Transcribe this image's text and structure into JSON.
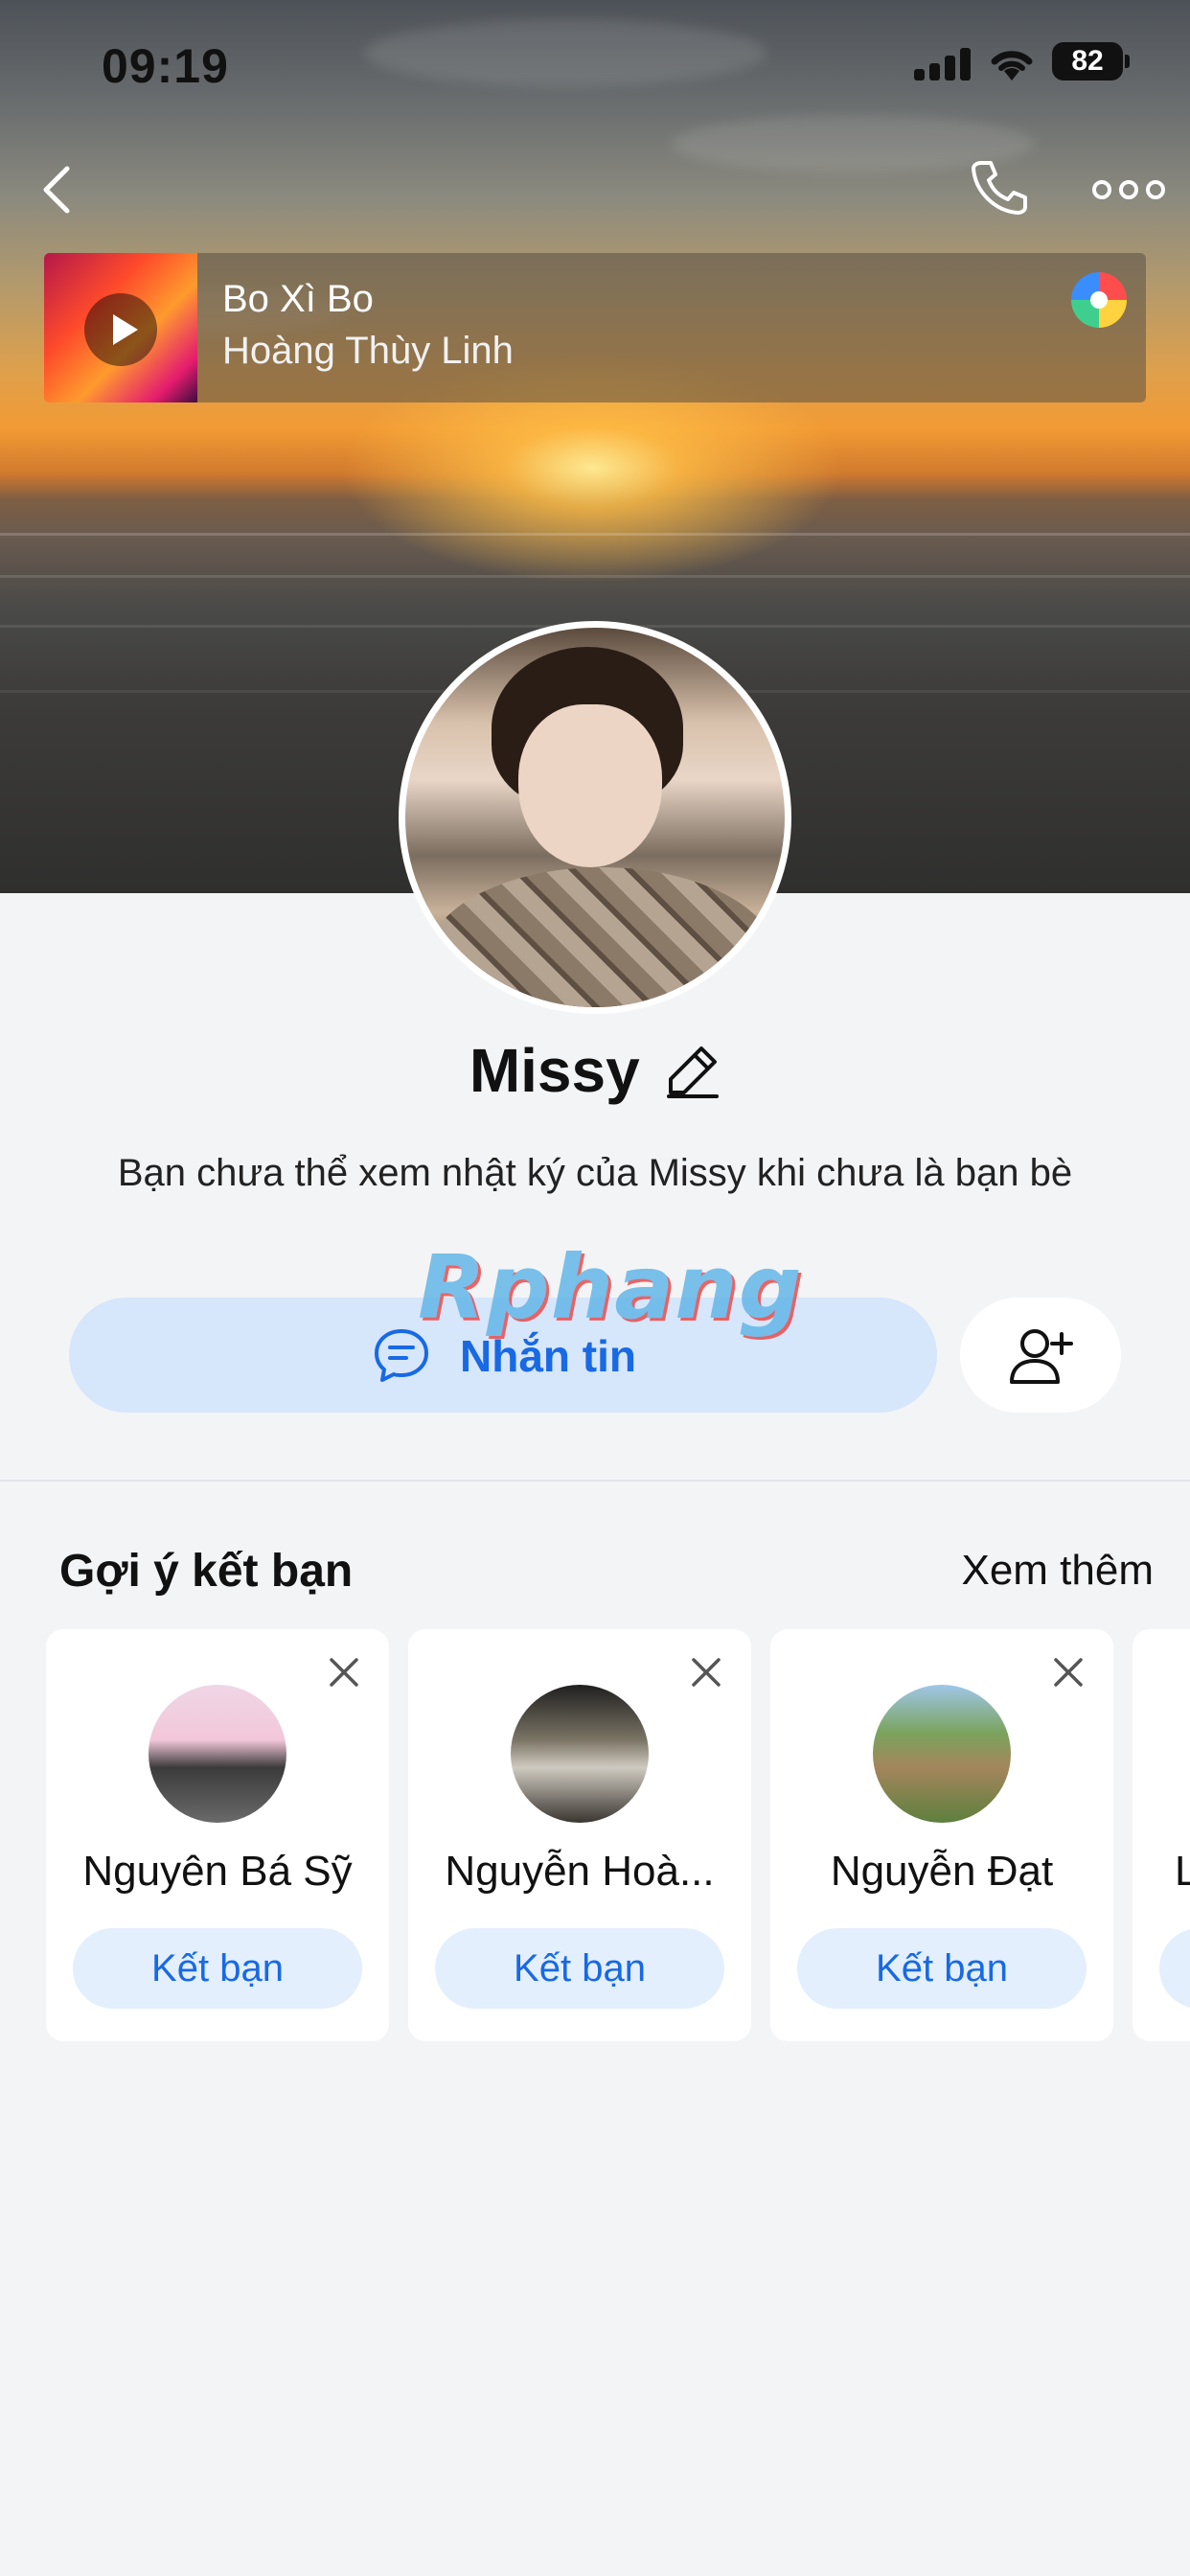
{
  "status_bar": {
    "time": "09:19",
    "battery": "82"
  },
  "music": {
    "title": "Bo Xì Bo",
    "artist": "Hoàng Thùy Linh"
  },
  "profile": {
    "name": "Missy",
    "note": "Bạn chưa thể xem nhật ký của Missy khi chưa là bạn bè"
  },
  "watermark": "Rphang",
  "actions": {
    "message_label": "Nhắn tin"
  },
  "suggestions": {
    "title": "Gợi ý kết bạn",
    "see_more": "Xem thêm",
    "items": [
      {
        "name": "Nguyên Bá Sỹ",
        "button": "Kết bạn"
      },
      {
        "name": "Nguyễn Hoà...",
        "button": "Kết bạn"
      },
      {
        "name": "Nguyễn Đạt",
        "button": "Kết bạn"
      },
      {
        "name": "L",
        "button": ""
      }
    ]
  },
  "colors": {
    "accent": "#1869e4",
    "accent_light": "#d6e6fb",
    "background": "#f3f4f6"
  },
  "icons": [
    "back-icon",
    "phone-icon",
    "more-icon",
    "play-icon",
    "music-disc-icon",
    "edit-icon",
    "chat-icon",
    "add-friend-icon",
    "close-icon"
  ]
}
